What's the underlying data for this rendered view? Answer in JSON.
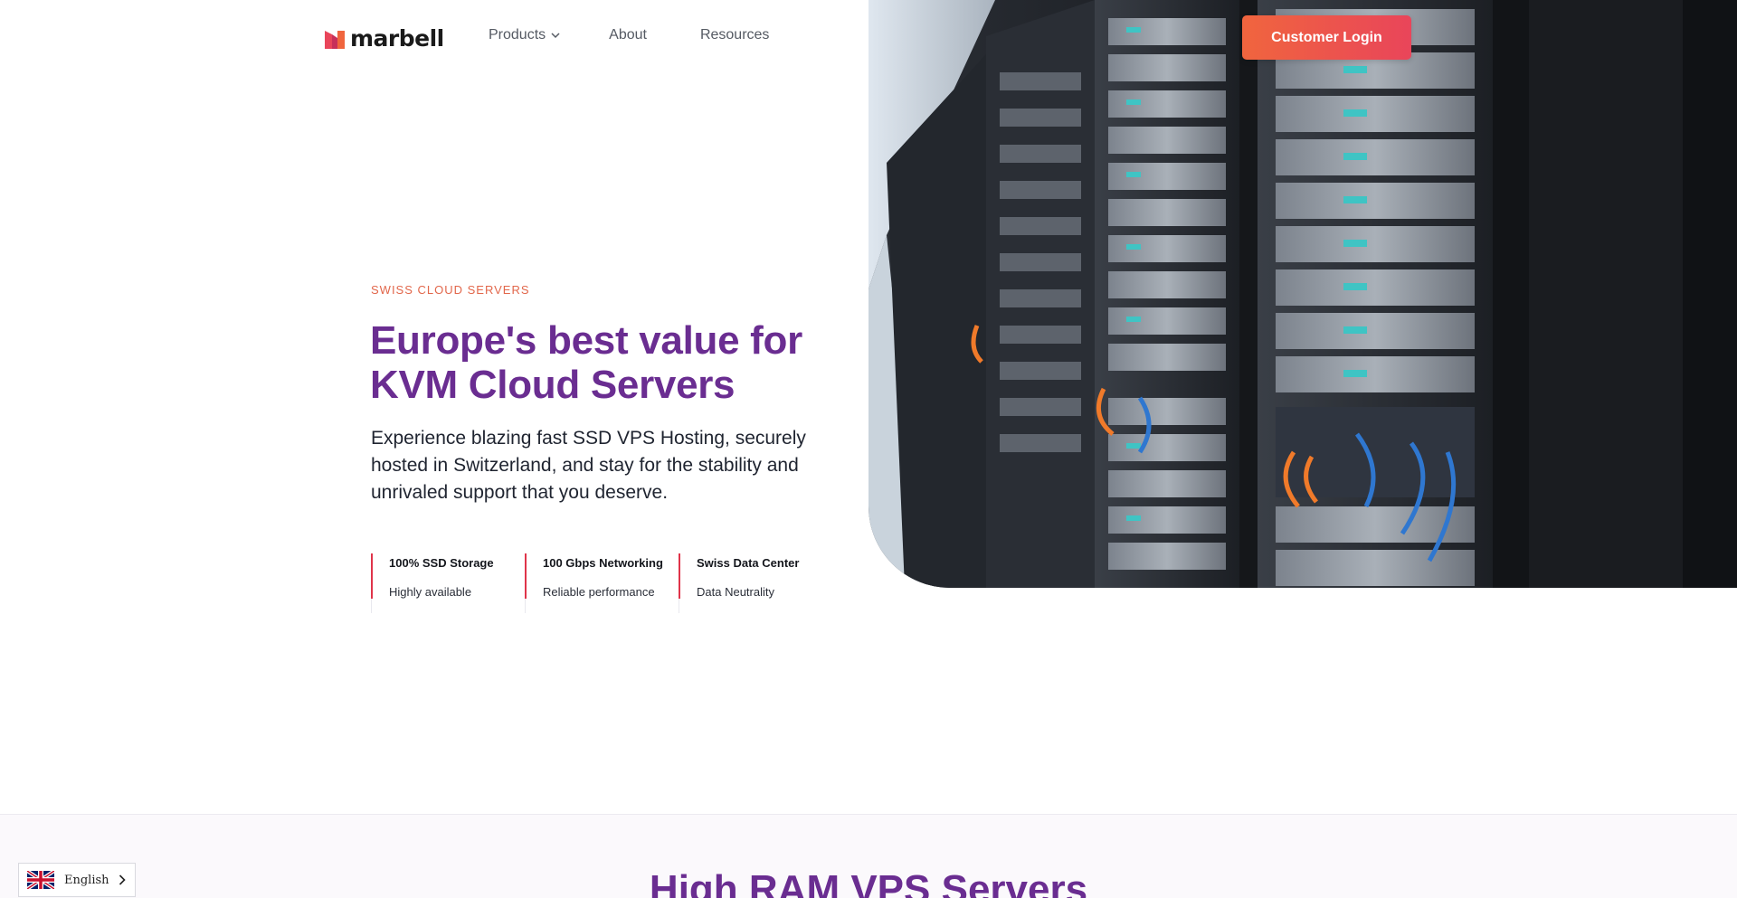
{
  "brand": {
    "name": "marbell",
    "logo_icon": "marbell-m-logo-icon",
    "accent": "#e9455a",
    "primary": "#6a2d91"
  },
  "nav": {
    "products_label": "Products",
    "about_label": "About",
    "resources_label": "Resources",
    "login_label": "Customer Login"
  },
  "hero": {
    "eyebrow": "SWISS CLOUD SERVERS",
    "headline_line1": "Europe's best value for",
    "headline_line2": "KVM Cloud Servers",
    "subtext": "Experience blazing fast SSD VPS Hosting, securely hosted in Switzerland, and stay for the stability and unrivaled support that you deserve.",
    "image": "server-racks-photo",
    "features": [
      {
        "title": "100% SSD Storage",
        "subtitle": "Highly available"
      },
      {
        "title": "100 Gbps Networking",
        "subtitle": "Reliable performance"
      },
      {
        "title": "Swiss Data Center",
        "subtitle": "Data Neutrality"
      }
    ]
  },
  "section2": {
    "title": "High RAM VPS Servers"
  },
  "language": {
    "current": "English",
    "flag": "uk-flag-icon"
  }
}
